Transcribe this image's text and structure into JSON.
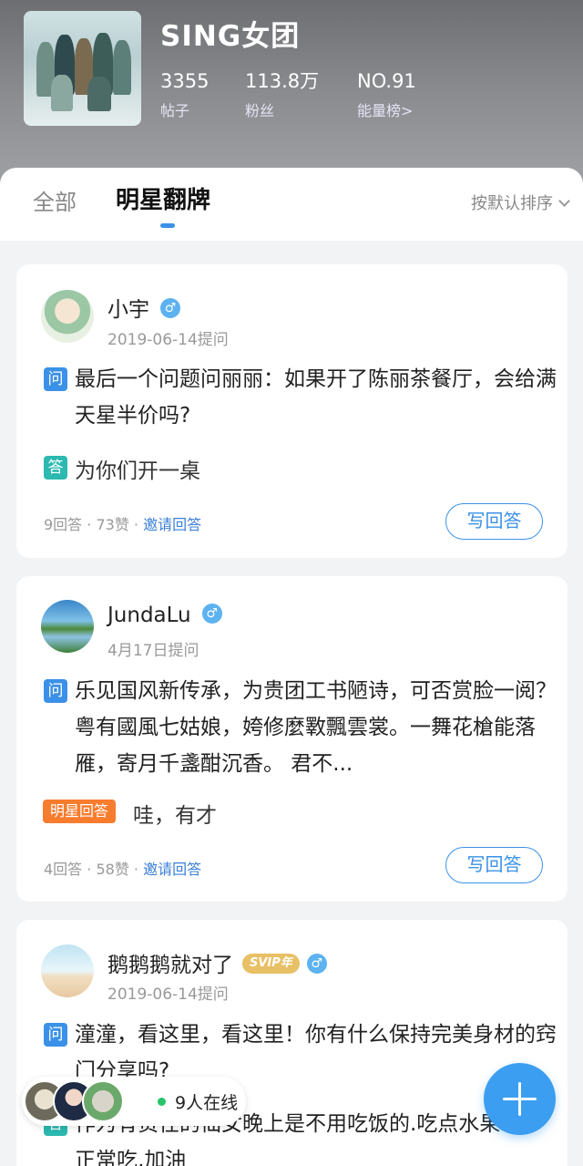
{
  "header": {
    "group_name": "SING女团",
    "stats": [
      {
        "value": "3355",
        "label": "帖子"
      },
      {
        "value": "113.8万",
        "label": "粉丝"
      },
      {
        "value": "NO.91",
        "label": "能量榜>"
      }
    ]
  },
  "tabs": {
    "all": "全部",
    "star": "明星翻牌",
    "sort": "按默认排序"
  },
  "cards": [
    {
      "username": "小宇",
      "gender_symbol": "♂",
      "date": "2019-06-14提问",
      "q_tag": "问",
      "question": "最后一个问题问丽丽：如果开了陈丽茶餐厅，会给满天星半价吗?",
      "a_tag": "答",
      "answer": "为你们开一桌",
      "answers": "9回答",
      "likes": "73赞",
      "invite": "邀请回答",
      "write": "写回答"
    },
    {
      "username": "JundaLu",
      "gender_symbol": "♂",
      "date": "4月17日提问",
      "q_tag": "问",
      "question": "乐见国风新传承，为贵团工书陋诗，可否赏脸一阅？ 粤有國風七姑娘，姱修麼斁飄雲裳。一舞花槍能落雁，寄月千盞酣沉香。 君不...",
      "a_tag": "明星回答",
      "answer": "哇，有才",
      "answers": "4回答",
      "likes": "58赞",
      "invite": "邀请回答",
      "write": "写回答"
    },
    {
      "username": "鹅鹅鹅就对了",
      "badge": "SVIP年",
      "gender_symbol": "♂",
      "date": "2019-06-14提问",
      "q_tag": "问",
      "question": "潼潼，看这里，看这里！你有什么保持完美身材的窍门分享吗?",
      "a_tag": "答",
      "answer": "作为有责任的仙女晚上是不用吃饭的.吃点水果中午正常吃,加油"
    }
  ],
  "online": {
    "text": "9人在线"
  },
  "colors": {
    "accent": "#3b91e7",
    "answer_tag": "#2bb9b0",
    "star_tag": "#f87c2e",
    "svip": "#e8c065"
  },
  "icons": [
    "male-icon",
    "chevron-down-icon",
    "plus-icon"
  ]
}
